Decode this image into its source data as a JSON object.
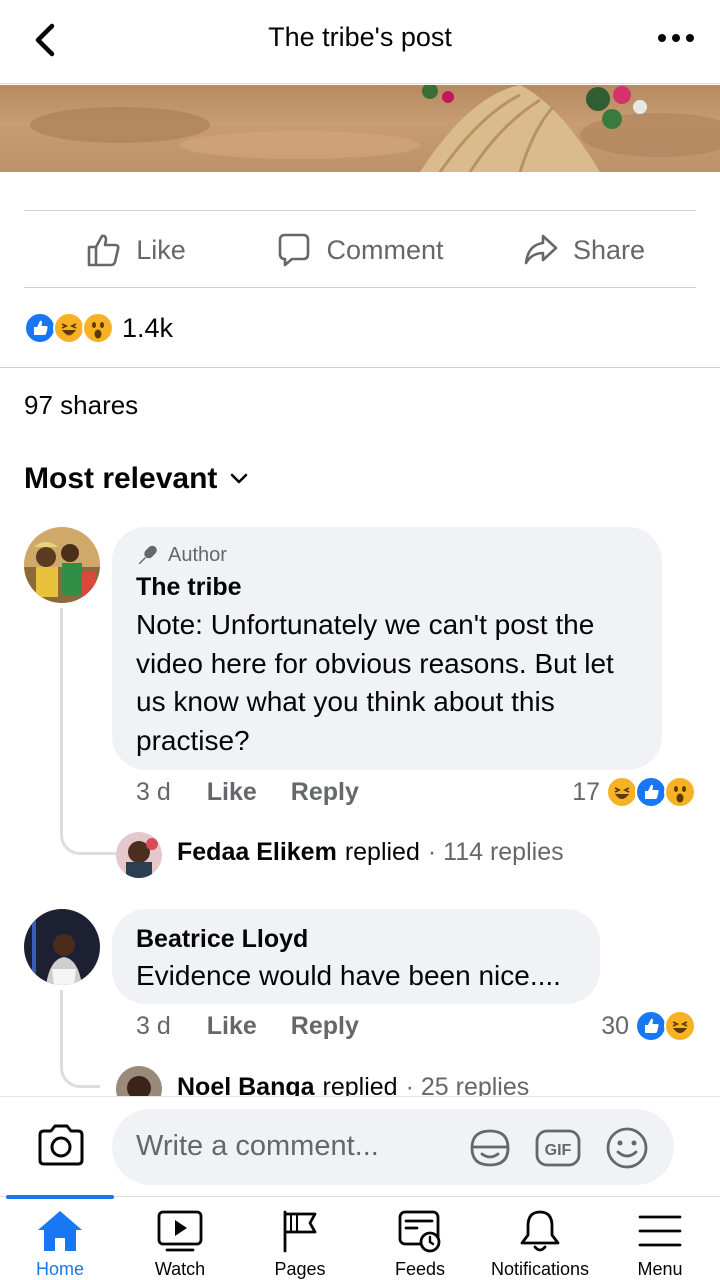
{
  "header": {
    "title": "The tribe's post"
  },
  "post_actions": {
    "like": "Like",
    "comment": "Comment",
    "share": "Share"
  },
  "reactions": {
    "count": "1.4k",
    "types": [
      "like",
      "haha",
      "wow"
    ]
  },
  "shares": "97 shares",
  "sort": {
    "label": "Most relevant"
  },
  "comments": [
    {
      "badge": "Author",
      "name": "The tribe",
      "text_lines": [
        "Note: Unfortunately we can't post the",
        "video here for obvious reasons. But let",
        "us know what you think about this",
        "practise?"
      ],
      "time": "3 d",
      "like": "Like",
      "reply": "Reply",
      "reaction_count": "17",
      "reaction_types": [
        "haha",
        "like",
        "wow"
      ],
      "reply_preview": {
        "name": "Fedaa Elikem",
        "verb": "replied",
        "count": "· 114 replies"
      }
    },
    {
      "name": "Beatrice Lloyd",
      "text_lines": [
        "Evidence would have been nice...."
      ],
      "time": "3 d",
      "like": "Like",
      "reply": "Reply",
      "reaction_count": "30",
      "reaction_types": [
        "like",
        "haha"
      ],
      "reply_preview": {
        "name": "Noel Banga",
        "verb": "replied",
        "count": "· 25 replies"
      }
    }
  ],
  "composer": {
    "placeholder": "Write a comment...",
    "gif": "GIF"
  },
  "tabs": [
    {
      "label": "Home",
      "active": true
    },
    {
      "label": "Watch"
    },
    {
      "label": "Pages"
    },
    {
      "label": "Feeds"
    },
    {
      "label": "Notifications"
    },
    {
      "label": "Menu"
    }
  ],
  "colors": {
    "accent": "#1877f2",
    "secondary_text": "#65676b",
    "bubble": "#f0f2f5"
  }
}
